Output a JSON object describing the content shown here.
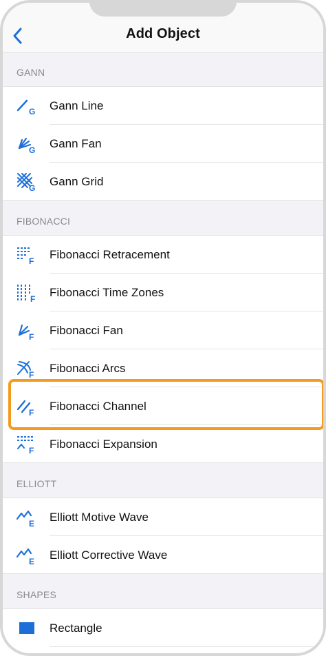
{
  "colors": {
    "accent": "#1d6fd8",
    "highlight": "#f39b1f",
    "section_bg": "#f2f2f7",
    "section_text": "#8a8a8e"
  },
  "navbar": {
    "title": "Add Object",
    "back_icon": "chevron-left-icon"
  },
  "sections": [
    {
      "header": "GANN",
      "items": [
        {
          "label": "Gann Line",
          "icon": "gann-line-icon"
        },
        {
          "label": "Gann Fan",
          "icon": "gann-fan-icon"
        },
        {
          "label": "Gann Grid",
          "icon": "gann-grid-icon"
        }
      ]
    },
    {
      "header": "FIBONACCI",
      "items": [
        {
          "label": "Fibonacci Retracement",
          "icon": "fibonacci-retracement-icon"
        },
        {
          "label": "Fibonacci Time Zones",
          "icon": "fibonacci-time-zones-icon"
        },
        {
          "label": "Fibonacci Fan",
          "icon": "fibonacci-fan-icon"
        },
        {
          "label": "Fibonacci Arcs",
          "icon": "fibonacci-arcs-icon"
        },
        {
          "label": "Fibonacci Channel",
          "icon": "fibonacci-channel-icon",
          "highlighted": true
        },
        {
          "label": "Fibonacci Expansion",
          "icon": "fibonacci-expansion-icon"
        }
      ]
    },
    {
      "header": "ELLIOTT",
      "items": [
        {
          "label": "Elliott Motive Wave",
          "icon": "elliott-motive-wave-icon"
        },
        {
          "label": "Elliott Corrective Wave",
          "icon": "elliott-corrective-wave-icon"
        }
      ]
    },
    {
      "header": "SHAPES",
      "items": [
        {
          "label": "Rectangle",
          "icon": "rectangle-icon"
        }
      ]
    }
  ]
}
